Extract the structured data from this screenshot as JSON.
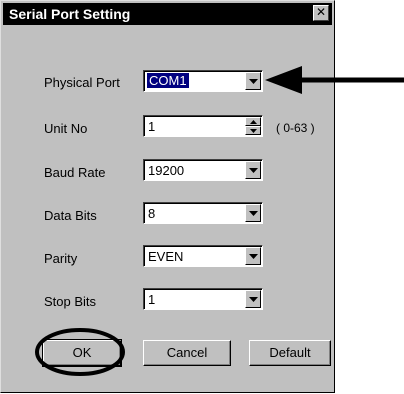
{
  "dialog": {
    "title": "Serial Port Setting",
    "close_glyph": "✕"
  },
  "fields": {
    "physical_port": {
      "label": "Physical Port",
      "value": "COM1"
    },
    "unit_no": {
      "label": "Unit No",
      "value": "1",
      "range": "( 0-63 )"
    },
    "baud_rate": {
      "label": "Baud Rate",
      "value": "19200"
    },
    "data_bits": {
      "label": "Data Bits",
      "value": "8"
    },
    "parity": {
      "label": "Parity",
      "value": "EVEN"
    },
    "stop_bits": {
      "label": "Stop Bits",
      "value": "1"
    }
  },
  "buttons": {
    "ok": "OK",
    "cancel": "Cancel",
    "default": "Default"
  },
  "icons": {
    "dropdown": "triangle-down-icon",
    "arrow": "arrow-left-icon",
    "highlight": "ellipse-circle"
  }
}
